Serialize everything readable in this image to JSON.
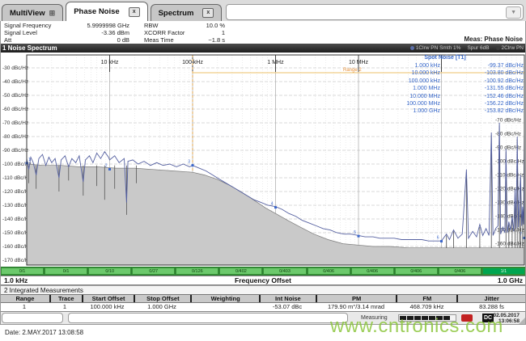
{
  "tabs": [
    {
      "label": "MultiView"
    },
    {
      "label": "Phase Noise",
      "close": "x"
    },
    {
      "label": "Spectrum",
      "close": "x"
    }
  ],
  "header": {
    "left": [
      {
        "label": "Signal Frequency",
        "value": "5.9999998 GHz"
      },
      {
        "label": "Signal Level",
        "value": "-3.36 dBm"
      },
      {
        "label": "Att",
        "value": "0 dB"
      }
    ],
    "right": [
      {
        "label": "RBW",
        "value": "10.0 %"
      },
      {
        "label": "XCORR Factor",
        "value": "1"
      },
      {
        "label": "Meas Time",
        "value": "~1.8 s"
      }
    ],
    "meas": "Meas: Phase Noise"
  },
  "window": {
    "title": "1 Noise Spectrum",
    "legend": [
      {
        "label": "1Clrw PN Smth 1%",
        "color": "#5b6ea8"
      },
      {
        "label": "Spur 6dB",
        "color": ""
      },
      {
        "label": "2Clrw PN",
        "color": "#3c3c3c"
      }
    ]
  },
  "spot_noise": {
    "title": "Spot Noise [T1]",
    "rows": [
      [
        "1.000 kHz",
        "-99.37 dBc/Hz"
      ],
      [
        "10.000 kHz",
        "-103.80 dBc/Hz"
      ],
      [
        "100.000 kHz",
        "-100.92 dBc/Hz"
      ],
      [
        "1.000 MHz",
        "-131.55 dBc/Hz"
      ],
      [
        "10.000 MHz",
        "-152.46 dBc/Hz"
      ],
      [
        "100.000 MHz",
        "-156.22 dBc/Hz"
      ],
      [
        "1.000 GHz",
        "-153.82 dBc/Hz"
      ]
    ]
  },
  "chart_data": {
    "type": "line",
    "title": "Noise Spectrum",
    "xscale": "log",
    "xlabel": "Frequency Offset",
    "x_start": "1.0 kHz",
    "x_stop": "1.0 GHz",
    "xlim_hz": [
      1000,
      1000000000
    ],
    "ylim": [
      -170,
      -30
    ],
    "yunit": "dBc/Hz",
    "grid": true,
    "legend_position": "top-right",
    "x_decade_labels": [
      {
        "f": 10000,
        "label": "10 kHz"
      },
      {
        "f": 100000,
        "label": "100 kHz"
      },
      {
        "f": 1000000,
        "label": "1 MHz"
      },
      {
        "f": 10000000,
        "label": "10 MHz"
      }
    ],
    "range2": {
      "label": "Range 2",
      "start_hz": 100000,
      "stop_hz": 1000000000
    },
    "series": [
      {
        "name": "1Clrw PN Smth 1%",
        "color": "#5560a0",
        "points": [
          [
            1000,
            -96
          ],
          [
            1060,
            -104
          ],
          [
            1120,
            -95
          ],
          [
            1200,
            -99
          ],
          [
            1300,
            -108
          ],
          [
            1400,
            -96
          ],
          [
            1550,
            -93
          ],
          [
            1700,
            -101
          ],
          [
            1850,
            -95
          ],
          [
            2000,
            -99
          ],
          [
            2200,
            -96
          ],
          [
            2450,
            -110
          ],
          [
            2600,
            -97
          ],
          [
            2900,
            -94
          ],
          [
            3200,
            -102
          ],
          [
            3500,
            -96
          ],
          [
            3900,
            -99
          ],
          [
            4300,
            -94
          ],
          [
            4800,
            -113
          ],
          [
            5100,
            -97
          ],
          [
            5700,
            -94
          ],
          [
            6300,
            -99
          ],
          [
            7000,
            -92
          ],
          [
            7800,
            -96
          ],
          [
            8700,
            -91
          ],
          [
            9700,
            -95
          ],
          [
            10000,
            -97
          ],
          [
            11500,
            -94
          ],
          [
            13000,
            -99
          ],
          [
            15000,
            -96
          ],
          [
            16000,
            -128
          ],
          [
            16600,
            -98
          ],
          [
            19000,
            -97
          ],
          [
            22000,
            -100
          ],
          [
            26000,
            -98
          ],
          [
            31000,
            -101
          ],
          [
            37000,
            -99
          ],
          [
            44000,
            -101
          ],
          [
            53000,
            -100
          ],
          [
            64000,
            -102
          ],
          [
            77000,
            -100
          ],
          [
            92000,
            -102
          ],
          [
            100000,
            -101
          ],
          [
            120000,
            -103
          ],
          [
            145000,
            -105
          ],
          [
            175000,
            -108
          ],
          [
            210000,
            -111
          ],
          [
            255000,
            -114
          ],
          [
            310000,
            -117
          ],
          [
            375000,
            -120
          ],
          [
            455000,
            -123
          ],
          [
            550000,
            -126
          ],
          [
            670000,
            -128
          ],
          [
            810000,
            -130
          ],
          [
            1000000,
            -131
          ],
          [
            1200000,
            -133
          ],
          [
            1450000,
            -136
          ],
          [
            1750000,
            -138
          ],
          [
            2100000,
            -141
          ],
          [
            2550000,
            -143
          ],
          [
            3100000,
            -145
          ],
          [
            3750000,
            -147
          ],
          [
            4550000,
            -148
          ],
          [
            5500000,
            -150
          ],
          [
            6700000,
            -151
          ],
          [
            8100000,
            -151
          ],
          [
            10000000,
            -152
          ],
          [
            12000000,
            -153
          ],
          [
            15000000,
            -153
          ],
          [
            18000000,
            -154
          ],
          [
            22000000,
            -154
          ],
          [
            27000000,
            -154
          ],
          [
            33000000,
            -155
          ],
          [
            40000000,
            -155
          ],
          [
            48000000,
            -155
          ],
          [
            58000000,
            -155
          ],
          [
            70000000,
            -156
          ],
          [
            85000000,
            -156
          ],
          [
            100000000,
            -156
          ],
          [
            115000000,
            -151
          ],
          [
            125000000,
            -155
          ],
          [
            140000000,
            -148
          ],
          [
            158000000,
            -154
          ],
          [
            178000000,
            -151
          ],
          [
            200000000,
            -104
          ],
          [
            212000000,
            -154
          ],
          [
            238000000,
            -149
          ],
          [
            265000000,
            -153
          ],
          [
            290000000,
            -144
          ],
          [
            315000000,
            -152
          ],
          [
            345000000,
            -147
          ],
          [
            375000000,
            -152
          ],
          [
            400000000,
            -77
          ],
          [
            418000000,
            -152
          ],
          [
            450000000,
            -147
          ],
          [
            480000000,
            -145
          ],
          [
            500000000,
            -70
          ],
          [
            518000000,
            -151
          ],
          [
            550000000,
            -146
          ],
          [
            582000000,
            -150
          ],
          [
            600000000,
            -89
          ],
          [
            622000000,
            -150
          ],
          [
            650000000,
            -142
          ],
          [
            682000000,
            -148
          ],
          [
            712000000,
            -138
          ],
          [
            745000000,
            -149
          ],
          [
            772000000,
            -118
          ],
          [
            795000000,
            -147
          ],
          [
            820000000,
            -80
          ],
          [
            848000000,
            -146
          ],
          [
            872000000,
            -127
          ],
          [
            900000000,
            -108
          ],
          [
            928000000,
            -145
          ],
          [
            952000000,
            -131
          ],
          [
            978000000,
            -144
          ],
          [
            1000000000,
            -72
          ]
        ]
      },
      {
        "name": "2Clrw PN",
        "color": "#7a7a7a",
        "fill": "#c9c9c9",
        "points": [
          [
            1000,
            -100
          ],
          [
            1600,
            -101
          ],
          [
            2600,
            -101
          ],
          [
            4200,
            -102
          ],
          [
            7000,
            -102
          ],
          [
            12000,
            -103
          ],
          [
            20000,
            -103
          ],
          [
            34000,
            -104
          ],
          [
            58000,
            -105
          ],
          [
            100000,
            -106
          ],
          [
            140000,
            -108
          ],
          [
            195000,
            -111
          ],
          [
            270000,
            -115
          ],
          [
            380000,
            -120
          ],
          [
            540000,
            -126
          ],
          [
            760000,
            -132
          ],
          [
            1000000,
            -136
          ],
          [
            1400000,
            -141
          ],
          [
            2000000,
            -146
          ],
          [
            2900000,
            -151
          ],
          [
            4300000,
            -155
          ],
          [
            6500000,
            -158
          ],
          [
            10000000,
            -159
          ],
          [
            15000000,
            -160
          ],
          [
            24000000,
            -160
          ],
          [
            40000000,
            -161
          ],
          [
            70000000,
            -161
          ],
          [
            120000000,
            -161
          ],
          [
            250000000,
            -161
          ],
          [
            500000000,
            -161
          ],
          [
            1000000000,
            -161
          ]
        ]
      }
    ],
    "spurs": [
      [
        115000000,
        -152
      ],
      [
        140000000,
        -149
      ],
      [
        200000000,
        -106
      ],
      [
        290000000,
        -146
      ],
      [
        400000000,
        -79
      ],
      [
        500000000,
        -72
      ],
      [
        600000000,
        -91
      ],
      [
        650000000,
        -144
      ],
      [
        712000000,
        -140
      ],
      [
        772000000,
        -120
      ],
      [
        820000000,
        -82
      ],
      [
        872000000,
        -129
      ],
      [
        900000000,
        -110
      ],
      [
        952000000,
        -133
      ],
      [
        1000000000,
        -74
      ]
    ],
    "dips": [
      [
        1060,
        -114
      ],
      [
        1300,
        -118
      ],
      [
        2450,
        -120
      ],
      [
        3200,
        -112
      ],
      [
        4800,
        -123
      ],
      [
        7000,
        -116
      ],
      [
        8700,
        -126
      ],
      [
        11500,
        -118
      ],
      [
        16000,
        -137
      ],
      [
        21000,
        -114
      ]
    ],
    "spot_markers": [
      {
        "n": 1,
        "f": 1000,
        "db": -99.37
      },
      {
        "n": 2,
        "f": 10000,
        "db": -103.8
      },
      {
        "n": 3,
        "f": 100000,
        "db": -100.92
      },
      {
        "n": 4,
        "f": 1000000,
        "db": -131.55
      },
      {
        "n": 5,
        "f": 10000000,
        "db": -152.46
      },
      {
        "n": 6,
        "f": 100000000,
        "db": -156.22
      },
      {
        "n": 7,
        "f": 1000000000,
        "db": -153.82
      }
    ]
  },
  "green_bar": {
    "segments": [
      "0/1",
      "0/1",
      "0/10",
      "0/27",
      "0/126",
      "0/402",
      "0/403",
      "0/406",
      "0/406",
      "0/406",
      "0/406",
      "1/1"
    ]
  },
  "axis_bar": {
    "start": "1.0 kHz",
    "label": "Frequency Offset",
    "stop": "1.0 GHz"
  },
  "integrated": {
    "title": "2 Integrated Measurements",
    "headers": [
      "Range",
      "Trace",
      "Start Offset",
      "Stop Offset",
      "Weighting",
      "Int Noise",
      "PM",
      "FM",
      "Jitter"
    ],
    "rows": [
      [
        "1",
        "1",
        "100.000 kHz",
        "1.000 GHz",
        "",
        "-53.07 dBc",
        "179.90 m°/3.14 mrad",
        "468.709 kHz",
        "83.288 fs"
      ]
    ]
  },
  "status": {
    "measuring": "Measuring",
    "dc": "DC",
    "date": "02.05.2017",
    "time": "13:06:58"
  },
  "footer": {
    "date_text": "Date: 2.MAY.2017  13:08:58",
    "watermark": "www.cntronics.com"
  }
}
